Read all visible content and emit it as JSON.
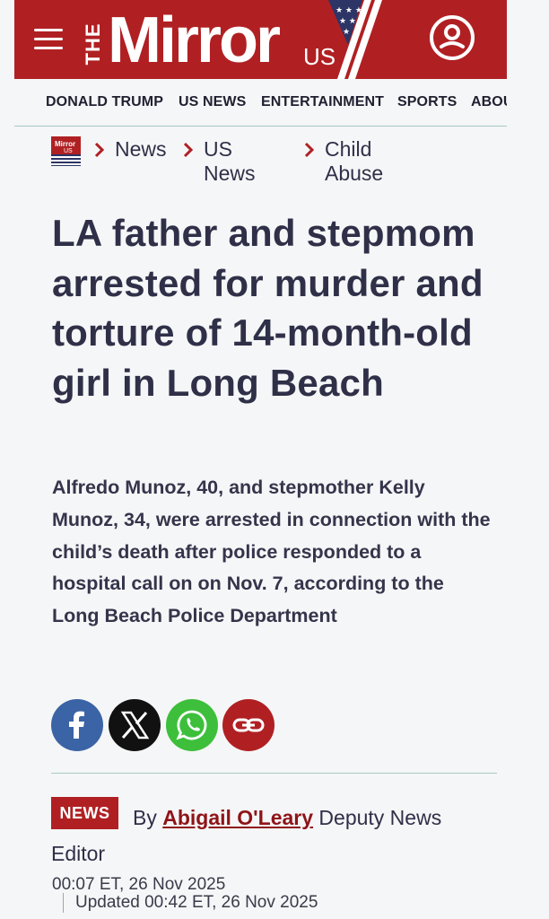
{
  "header": {
    "logo_the": "THE",
    "logo_name": "Mirror",
    "logo_region": "US",
    "menu_icon": "hamburger-menu-icon",
    "user_icon": "user-account-icon",
    "brand_color": "#b02023"
  },
  "nav": {
    "items": [
      "DONALD TRUMP",
      "US NEWS",
      "ENTERTAINMENT",
      "SPORTS",
      "ABOU"
    ]
  },
  "breadcrumb": {
    "logo_text": "Mirror",
    "logo_region": "US",
    "items": [
      "News",
      "US News",
      "Child Abuse"
    ]
  },
  "article": {
    "headline": "LA father and stepmom arrested for murder and torture of 14-month-old girl in Long Beach",
    "standfirst": "Alfredo Munoz, 40, and stepmother Kelly Munoz, 34, were arrested in connection with the child’s death after police responded to a hospital call on on Nov. 7, according to the Long Beach Police Department",
    "share": [
      {
        "icon": "facebook-icon",
        "color": "#3b64a6"
      },
      {
        "icon": "x-icon",
        "color": "#111111"
      },
      {
        "icon": "whatsapp-icon",
        "color": "#3dbf3b"
      },
      {
        "icon": "link-icon",
        "color": "#b02023"
      }
    ],
    "badge": "NEWS",
    "byline_prefix": "By",
    "author": "Abigail O'Leary",
    "author_role": "Deputy News Editor",
    "published": "00:07 ET, 26 Nov 2025",
    "updated": "Updated 00:42 ET, 26 Nov 2025"
  }
}
